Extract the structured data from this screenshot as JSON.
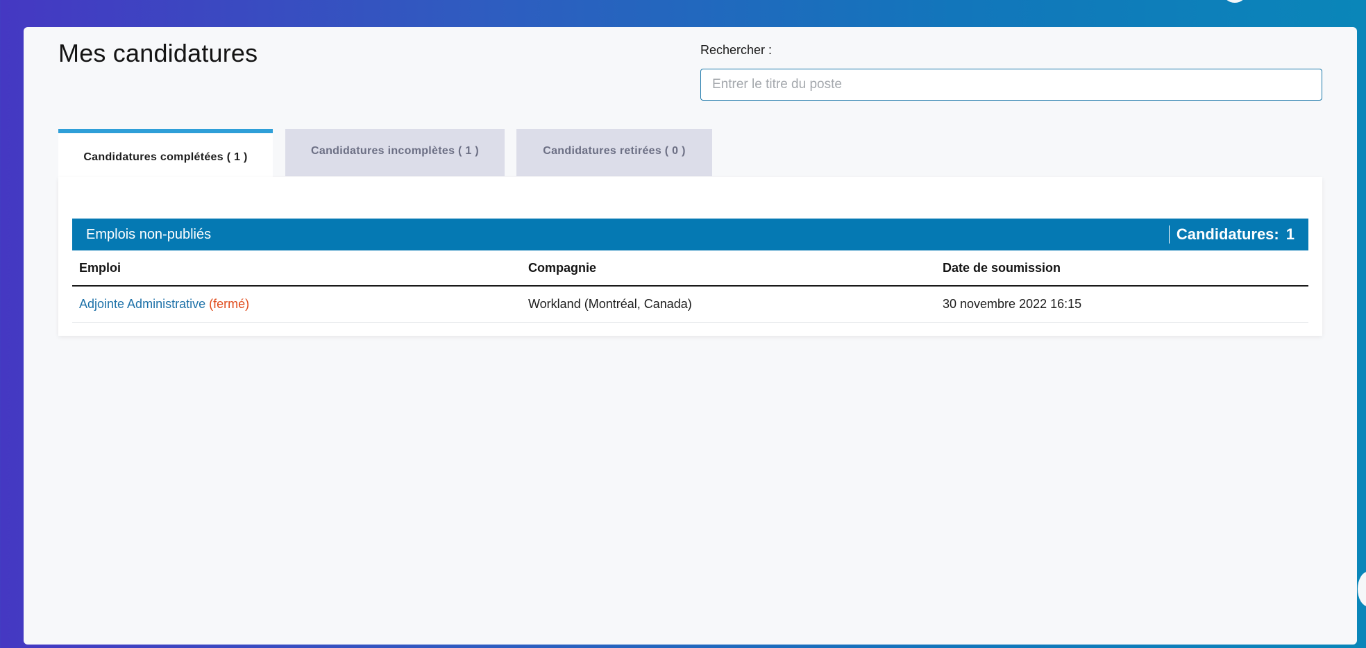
{
  "page": {
    "title": "Mes candidatures"
  },
  "search": {
    "label": "Rechercher :",
    "placeholder": "Entrer le titre du poste",
    "value": ""
  },
  "tabs": [
    {
      "label": "Candidatures complétées ( 1 )",
      "active": true
    },
    {
      "label": "Candidatures incomplètes ( 1 )",
      "active": false
    },
    {
      "label": "Candidatures retirées ( 0 )",
      "active": false
    }
  ],
  "group": {
    "title": "Emplois non-publiés",
    "count_label": "Candidatures:",
    "count_value": "1"
  },
  "table": {
    "headers": [
      "Emploi",
      "Compagnie",
      "Date de soumission"
    ],
    "rows": [
      {
        "job": "Adjointe Administrative",
        "status": "(fermé)",
        "company": "Workland (Montréal, Canada)",
        "date": "30 novembre 2022 16:15"
      }
    ]
  },
  "colors": {
    "accent": "#0579b3",
    "tab_indicator": "#2f9fd8",
    "link": "#1d71a8",
    "closed_status": "#e04a1a",
    "background_gradient_start": "#4538c2",
    "background_gradient_end": "#0a86b9"
  }
}
